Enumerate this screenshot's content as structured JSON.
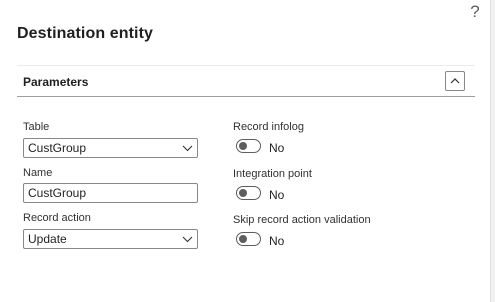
{
  "dialog": {
    "help_label": "?",
    "title": "Destination entity"
  },
  "section": {
    "title": "Parameters",
    "collapse_icon": "chevron-up-icon",
    "expanded": true
  },
  "left_fields": {
    "table": {
      "label": "Table",
      "value": "CustGroup"
    },
    "name": {
      "label": "Name",
      "value": "CustGroup"
    },
    "record_action": {
      "label": "Record action",
      "value": "Update"
    }
  },
  "right_fields": {
    "record_infolog": {
      "label": "Record infolog",
      "state": "No"
    },
    "integration_point": {
      "label": "Integration point",
      "state": "No"
    },
    "skip_validation": {
      "label": "Skip record action validation",
      "state": "No"
    }
  },
  "colors": {
    "text": "#323130",
    "border": "#8a8886",
    "toggle_off": "#605e5c"
  }
}
